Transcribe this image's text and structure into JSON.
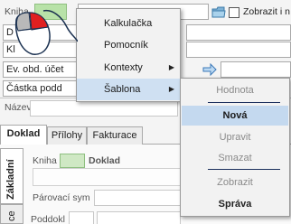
{
  "form": {
    "kniha_label": "Kniha",
    "zobrazit_label": "Zobrazit i n",
    "field_d_label": "D",
    "field_k_label": "Kl",
    "ev_obd_label": "Ev. obd. účet",
    "castka_label": "Částka podd",
    "nazev_label": "Název",
    "tabs": [
      "Doklad",
      "Přílohy",
      "Fakturace"
    ],
    "vtab_zakladni": "Základní",
    "vtab_second": "ce",
    "inner_kniha_label": "Kniha",
    "inner_doklad_label": "Doklad",
    "parovaci_label": "Párovací sym",
    "poddokl_label": "Poddokl"
  },
  "context_menu": {
    "items": [
      {
        "label": "Kalkulačka",
        "has_submenu": false
      },
      {
        "label": "Pomocník",
        "has_submenu": false
      },
      {
        "label": "Kontexty",
        "has_submenu": true
      },
      {
        "label": "Šablona",
        "has_submenu": true,
        "highlighted": true
      }
    ]
  },
  "submenu": {
    "items": [
      {
        "label": "Hodnota",
        "state": "disabled"
      },
      {
        "label": "Nová",
        "state": "highlighted"
      },
      {
        "label": "Upravit",
        "state": "disabled"
      },
      {
        "label": "Smazat",
        "state": "disabled"
      },
      {
        "label": "Zobrazit",
        "state": "disabled"
      },
      {
        "label": "Správa",
        "state": "bold"
      }
    ]
  },
  "colors": {
    "menu_highlight": "#cfe0f2",
    "submenu_highlight": "#c4d9ef",
    "green_field": "#b8e2a8",
    "mouse_button_red": "#e02020"
  }
}
